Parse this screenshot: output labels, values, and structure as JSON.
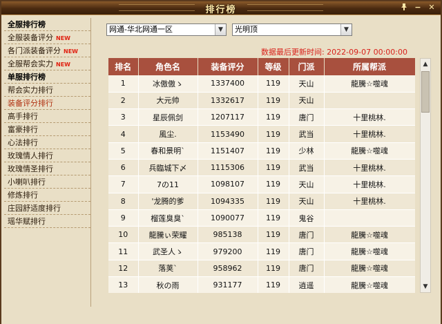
{
  "window": {
    "title": "排行榜",
    "pin_icon": "pin-icon",
    "minimize_label": "−",
    "close_label": "✕"
  },
  "sidebar": {
    "items": [
      {
        "label": "全服排行榜",
        "type": "head"
      },
      {
        "label": "全服装备评分",
        "type": "item",
        "badge": "NEW"
      },
      {
        "label": "各门派装备评分",
        "type": "item",
        "badge": "NEW"
      },
      {
        "label": "全服帮会实力",
        "type": "item",
        "badge": "NEW"
      },
      {
        "label": "单服排行榜",
        "type": "head"
      },
      {
        "label": "帮会实力排行",
        "type": "item"
      },
      {
        "label": "装备评分排行",
        "type": "item",
        "active": true
      },
      {
        "label": "高手排行",
        "type": "item"
      },
      {
        "label": "富豪排行",
        "type": "item"
      },
      {
        "label": "心法排行",
        "type": "item"
      },
      {
        "label": "玫瑰情人排行",
        "type": "item"
      },
      {
        "label": "玫瑰情圣排行",
        "type": "item"
      },
      {
        "label": "小喇叭排行",
        "type": "item"
      },
      {
        "label": "修炼排行",
        "type": "item"
      },
      {
        "label": "庄园舒适度排行",
        "type": "item"
      },
      {
        "label": "瑶华赋排行",
        "type": "item"
      }
    ]
  },
  "filters": {
    "region": "网通-华北网通一区",
    "server": "光明顶"
  },
  "update_text": "数据最后更新时间: 2022-09-07 00:00:00",
  "table": {
    "headers": [
      "排名",
      "角色名",
      "装备评分",
      "等级",
      "门派",
      "所属帮派"
    ],
    "rows": [
      [
        "1",
        "冰傲傲ゝ",
        "1337400",
        "119",
        "天山",
        "龍騰☆噬魂"
      ],
      [
        "2",
        "大元帅",
        "1332617",
        "119",
        "天山",
        ""
      ],
      [
        "3",
        "星辰佩剑",
        "1207117",
        "119",
        "唐门",
        "十里桃林."
      ],
      [
        "4",
        "風尘.",
        "1153490",
        "119",
        "武当",
        "十里桃林."
      ],
      [
        "5",
        "春和景明`",
        "1151407",
        "119",
        "少林",
        "龍騰☆噬魂"
      ],
      [
        "6",
        "兵臨城下〆",
        "1115306",
        "119",
        "武当",
        "十里桃林."
      ],
      [
        "7",
        "7の11",
        "1098107",
        "119",
        "天山",
        "十里桃林."
      ],
      [
        "8",
        "'龙腾的爹",
        "1094335",
        "119",
        "天山",
        "十里桃林."
      ],
      [
        "9",
        "榴莲臭臭`",
        "1090077",
        "119",
        "鬼谷",
        ""
      ],
      [
        "10",
        "龍騰ぃ荣耀",
        "985138",
        "119",
        "唐门",
        "龍騰☆噬魂"
      ],
      [
        "11",
        "武圣人ゝ",
        "979200",
        "119",
        "唐门",
        "龍騰☆噬魂"
      ],
      [
        "12",
        "落荚`",
        "958962",
        "119",
        "唐门",
        "龍騰☆噬魂"
      ],
      [
        "13",
        "秋の雨",
        "931177",
        "119",
        "逍遥",
        "龍騰☆噬魂"
      ],
      [
        "14",
        "",
        "",
        "",
        "",
        ""
      ]
    ]
  }
}
